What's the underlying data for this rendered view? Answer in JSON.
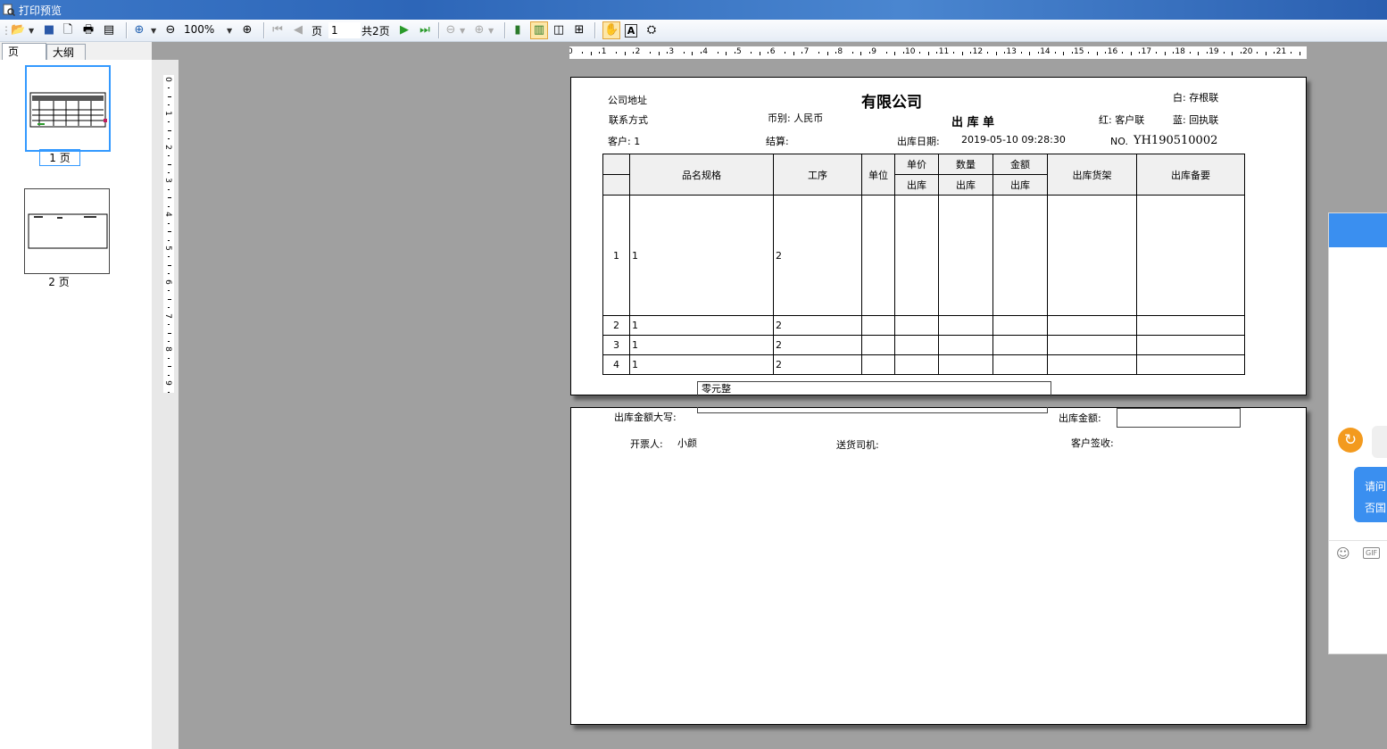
{
  "window": {
    "title": "打印预览"
  },
  "toolbar": {
    "zoom": "100%",
    "page_label": "页",
    "page_value": "1",
    "total_pages": "共2页"
  },
  "left_tabs": [
    "页",
    "大纲"
  ],
  "thumbnails": [
    "1 页",
    "2 页"
  ],
  "ruler": {
    "h_ticks": [
      "0",
      "1",
      "2",
      "3",
      "4",
      "5",
      "6",
      "7",
      "8",
      "9",
      "10",
      "11",
      "12",
      "13",
      "14",
      "15",
      "16",
      "17",
      "18",
      "19",
      "20",
      "21"
    ],
    "v_ticks": [
      "0",
      "1",
      "2",
      "3",
      "4",
      "5",
      "6",
      "7",
      "8",
      "9"
    ]
  },
  "doc": {
    "company": "有限公司",
    "address_label": "公司地址",
    "contact_label": "联系方式",
    "currency": "币别: 人民币",
    "doc_title": "出 库 单",
    "copy_white": "白: 存根联",
    "copy_red": "红: 客户联",
    "copy_blue": "蓝: 回执联",
    "customer": "客户: 1",
    "settlement": "结算:",
    "date_label": "出库日期:",
    "date_value": "2019-05-10 09:28:30",
    "no_label": "NO.",
    "no_value": "YH190510002",
    "columns": {
      "name": "品名规格",
      "process": "工序",
      "unit": "单位",
      "price": "单价",
      "qty": "数量",
      "amount": "金额",
      "out": "出库",
      "shelf": "出库货架",
      "remark": "出库备要"
    },
    "rows": [
      {
        "idx": "1",
        "name": "1",
        "process": "2"
      },
      {
        "idx": "2",
        "name": "1",
        "process": "2"
      },
      {
        "idx": "3",
        "name": "1",
        "process": "2"
      },
      {
        "idx": "4",
        "name": "1",
        "process": "2"
      }
    ],
    "amount_words_value": "零元整",
    "amount_words_label": "出库金额大写:",
    "amount_label": "出库金额:",
    "issuer_label": "开票人:",
    "issuer": "小颜",
    "driver_label": "送货司机:",
    "sign_label": "客户签收:"
  },
  "chat": {
    "msg_line1": "请问",
    "msg_line2": "否国"
  },
  "colors": {
    "accent": "#3a8ff0",
    "selection": "#3399ff"
  }
}
